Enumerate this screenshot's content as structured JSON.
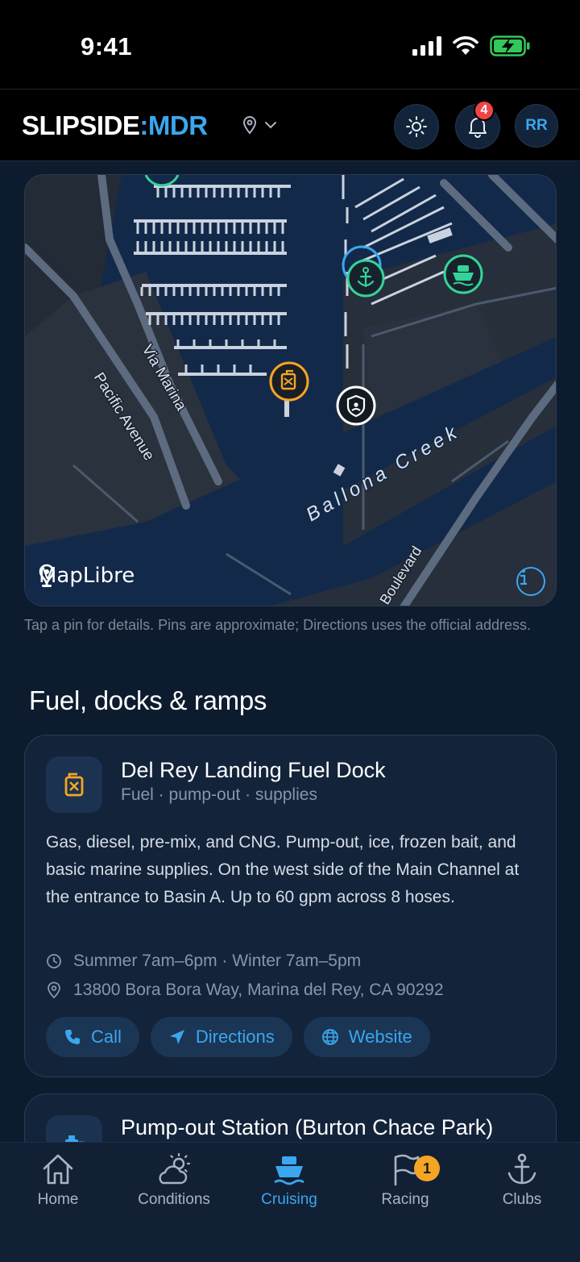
{
  "status": {
    "time": "9:41"
  },
  "header": {
    "brand_main": "SLIPSIDE",
    "brand_sep": ":",
    "brand_accent": "MDR",
    "avatar_initials": "RR",
    "notification_count": "4"
  },
  "map": {
    "labels": {
      "via_marina": "Via Marina",
      "pacific_avenue": "Pacific Avenue",
      "ballona_creek": "Ballona Creek",
      "boulevard": "Boulevard"
    },
    "attribution": "MapLibre",
    "pins": [
      {
        "type": "fuel",
        "icon": "fuel-pump-icon",
        "color": "#f5a524"
      },
      {
        "type": "anchorage",
        "icon": "anchor-icon",
        "color": "#34d399"
      },
      {
        "type": "ferry",
        "icon": "ship-icon",
        "color": "#34d399"
      },
      {
        "type": "patrol",
        "icon": "shield-icon",
        "color": "#ffffff"
      },
      {
        "type": "location",
        "icon": "location-ring-icon",
        "color": "#3aa7ee"
      }
    ],
    "colors": {
      "water": "#13294a",
      "land": "#262f3b",
      "road": "#5c6b80"
    }
  },
  "map_note": "Tap a pin for details. Pins are approximate; Directions uses the official address.",
  "section": {
    "title": "Fuel, docks & ramps"
  },
  "cards": [
    {
      "title": "Del Rey Landing Fuel Dock",
      "subtitle": "Fuel · pump-out · supplies",
      "description": "Gas, diesel, pre-mix, and CNG. Pump-out, ice, frozen bait, and basic marine supplies. On the west side of the Main Channel at the entrance to Basin A. Up to 60 gpm across 8 hoses.",
      "hours": "Summer 7am–6pm · Winter 7am–5pm",
      "address": "13800 Bora Bora Way, Marina del Rey, CA 90292",
      "actions": {
        "call": "Call",
        "directions": "Directions",
        "website": "Website"
      },
      "icon": "fuel-pump-icon"
    },
    {
      "title": "Pump-out Station (Burton Chace Park)",
      "icon": "pump-out-icon"
    }
  ],
  "tabs": [
    {
      "label": "Home",
      "icon": "home-icon"
    },
    {
      "label": "Conditions",
      "icon": "weather-icon"
    },
    {
      "label": "Cruising",
      "icon": "ship-icon",
      "active": true
    },
    {
      "label": "Racing",
      "icon": "flag-icon",
      "badge": "1"
    },
    {
      "label": "Clubs",
      "icon": "anchor-icon"
    }
  ],
  "colors": {
    "accent": "#3aa7ee",
    "fuel": "#f5a524",
    "green": "#34d399",
    "alert": "#ef4444"
  }
}
